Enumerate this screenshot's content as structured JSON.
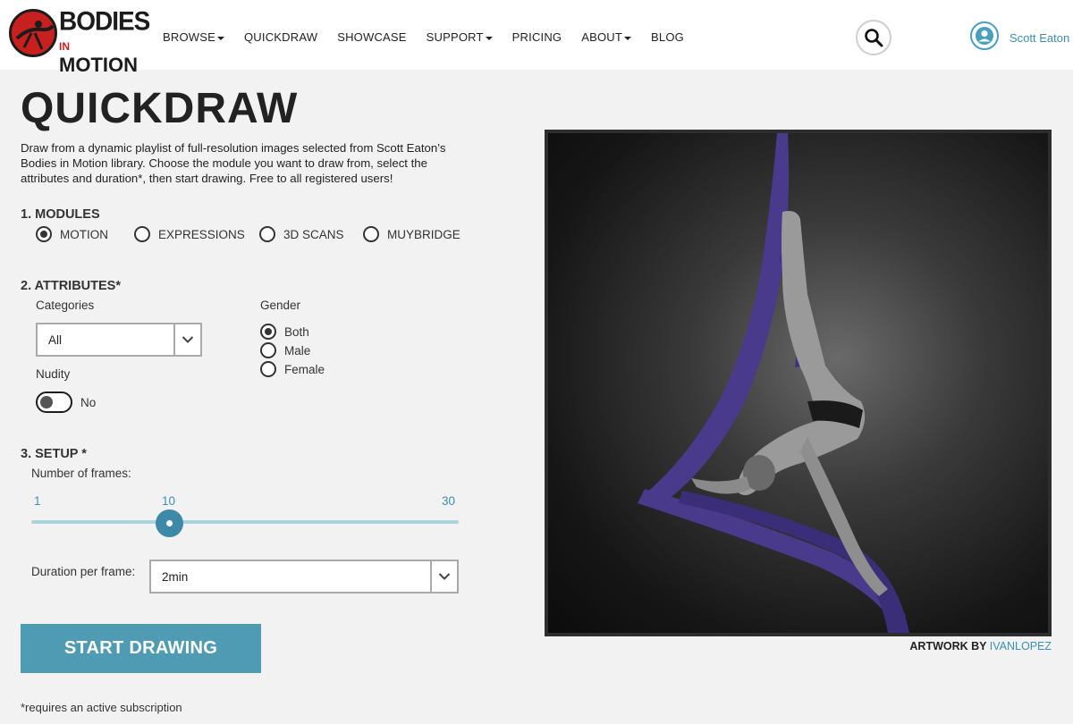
{
  "brand": {
    "line1": "BODIES",
    "line2a": "IN",
    "line2b": "MOTION"
  },
  "nav": [
    {
      "label": "BROWSE",
      "dropdown": true
    },
    {
      "label": "QUICKDRAW",
      "dropdown": false
    },
    {
      "label": "SHOWCASE",
      "dropdown": false
    },
    {
      "label": "SUPPORT",
      "dropdown": true
    },
    {
      "label": "PRICING",
      "dropdown": false
    },
    {
      "label": "ABOUT",
      "dropdown": true
    },
    {
      "label": "BLOG",
      "dropdown": false
    }
  ],
  "user": {
    "name": "Scott Eaton"
  },
  "page": {
    "title": "QUICKDRAW",
    "intro": "Draw from a dynamic playlist of full-resolution images selected from Scott Eaton’s Bodies in Motion library. Choose the module you want to draw from, select the attributes and duration*, then start drawing. Free to all registered users!"
  },
  "modules": {
    "heading": "1. MODULES",
    "options": [
      {
        "label": "MOTION",
        "selected": true
      },
      {
        "label": "EXPRESSIONS",
        "selected": false
      },
      {
        "label": "3D SCANS",
        "selected": false
      },
      {
        "label": "MUYBRIDGE",
        "selected": false
      }
    ]
  },
  "attributes": {
    "heading": "2. ATTRIBUTES*",
    "categories_label": "Categories",
    "categories_value": "All",
    "gender_label": "Gender",
    "gender_options": [
      {
        "label": "Both",
        "selected": true
      },
      {
        "label": "Male",
        "selected": false
      },
      {
        "label": "Female",
        "selected": false
      }
    ],
    "nudity_label": "Nudity",
    "nudity_value": "No",
    "nudity_on": false
  },
  "setup": {
    "heading": "3. SETUP *",
    "frames_label": "Number of frames:",
    "frames_min": "1",
    "frames_value": "10",
    "frames_max": "30",
    "duration_label": "Duration per frame:",
    "duration_value": "2min"
  },
  "actions": {
    "start_label": "START DRAWING"
  },
  "footnote": "*requires an active subscription",
  "artwork": {
    "credit_prefix": "ARTWORK BY",
    "credit_name": "IVANLOPEZ"
  },
  "colors": {
    "accent": "#4e9bb3",
    "link": "#3c8fb5",
    "brand_red": "#c8201e",
    "silk": "#4a3a8c"
  }
}
